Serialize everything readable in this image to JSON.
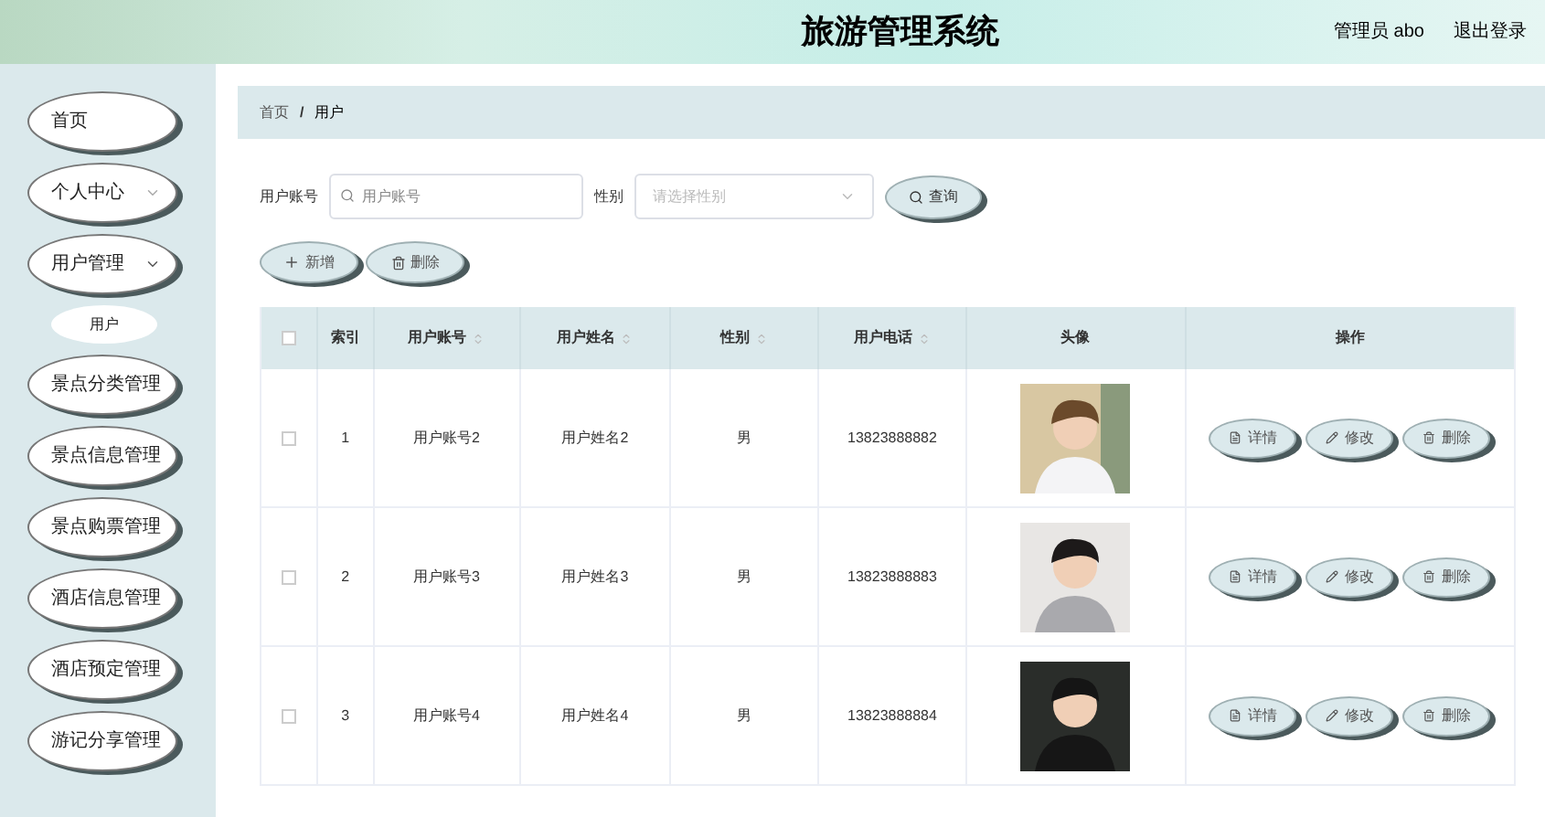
{
  "header": {
    "title": "旅游管理系统",
    "user": "管理员 abo",
    "logout": "退出登录"
  },
  "sidebar": {
    "items": [
      {
        "label": "首页",
        "kind": "link"
      },
      {
        "label": "个人中心",
        "kind": "submenu",
        "expanded": false
      },
      {
        "label": "用户管理",
        "kind": "submenu",
        "expanded": true,
        "children": [
          {
            "label": "用户",
            "selected": true
          }
        ]
      },
      {
        "label": "景点分类管理",
        "kind": "link"
      },
      {
        "label": "景点信息管理",
        "kind": "link"
      },
      {
        "label": "景点购票管理",
        "kind": "link"
      },
      {
        "label": "酒店信息管理",
        "kind": "link"
      },
      {
        "label": "酒店预定管理",
        "kind": "link"
      },
      {
        "label": "游记分享管理",
        "kind": "link"
      }
    ]
  },
  "breadcrumb": {
    "items": [
      "首页",
      "用户"
    ],
    "separator": "/"
  },
  "search": {
    "account_label": "用户账号",
    "account_placeholder": "用户账号",
    "gender_label": "性别",
    "gender_placeholder": "请选择性别",
    "query_button": "查询"
  },
  "actions": {
    "add": "新增",
    "delete": "删除"
  },
  "table": {
    "select_all_checked": false,
    "columns": [
      "索引",
      "用户账号",
      "用户姓名",
      "性别",
      "用户电话",
      "头像",
      "操作"
    ],
    "rows": [
      {
        "checked": false,
        "index": "1",
        "account": "用户账号2",
        "name": "用户姓名2",
        "gender": "男",
        "phone": "13823888882",
        "buttons": [
          "详情",
          "修改",
          "删除"
        ]
      },
      {
        "checked": false,
        "index": "2",
        "account": "用户账号3",
        "name": "用户姓名3",
        "gender": "男",
        "phone": "13823888883",
        "buttons": [
          "详情",
          "修改",
          "删除"
        ]
      },
      {
        "checked": false,
        "index": "3",
        "account": "用户账号4",
        "name": "用户姓名4",
        "gender": "男",
        "phone": "13823888884",
        "buttons": [
          "详情",
          "修改",
          "删除"
        ]
      }
    ]
  }
}
